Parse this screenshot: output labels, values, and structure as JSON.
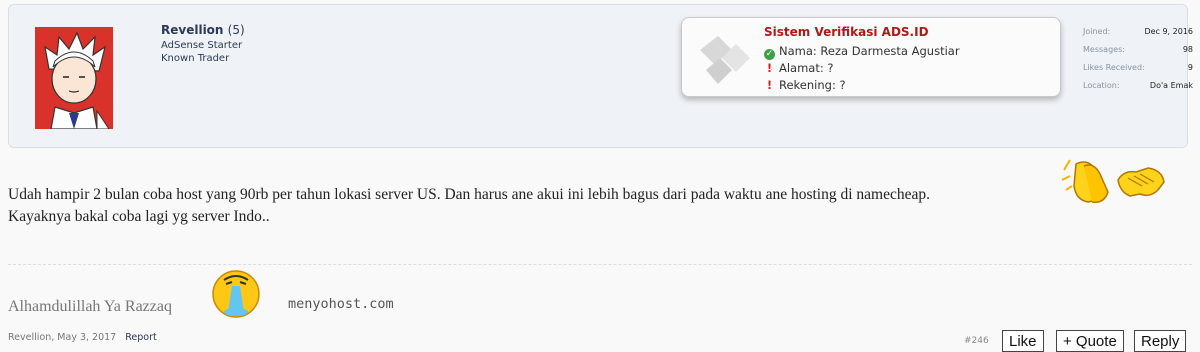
{
  "user": {
    "name": "Revellion",
    "count": "(5)",
    "titles": [
      "AdSense Starter",
      "Known Trader"
    ]
  },
  "verification": {
    "title": "Sistem Verifikasi ADS.ID",
    "rows": [
      {
        "status": "ok",
        "text": "Nama: Reza Darmesta Agustiar"
      },
      {
        "status": "warn",
        "text": "Alamat: ?"
      },
      {
        "status": "warn",
        "text": "Rekening: ?"
      }
    ]
  },
  "stats": [
    {
      "label": "Joined:",
      "value": "Dec 9, 2016"
    },
    {
      "label": "Messages:",
      "value": "98"
    },
    {
      "label": "Likes Received:",
      "value": "9"
    },
    {
      "label": "Location:",
      "value": "Do'a Emak"
    }
  ],
  "message": {
    "line1": "Udah hampir 2 bulan coba host yang 90rb per tahun lokasi server US. Dan harus ane akui ini lebih bagus dari pada waktu ane hosting di namecheap.",
    "line2": "Kayaknya bakal coba lagi yg server Indo.."
  },
  "signature": {
    "text": "Alhamdulillah Ya Razzaq",
    "url": "menyohost.com"
  },
  "meta": {
    "author": "Revellion",
    "date": "May 3, 2017",
    "report": "Report",
    "post_number": "#246"
  },
  "actions": {
    "like": "Like",
    "quote": "+ Quote",
    "reply": "Reply"
  },
  "icons": {
    "ok": "check-circle-icon",
    "warn": "exclamation-icon"
  },
  "colors": {
    "verif_title": "#b01818",
    "ok": "#3ea043",
    "warn": "#d01f1f"
  }
}
